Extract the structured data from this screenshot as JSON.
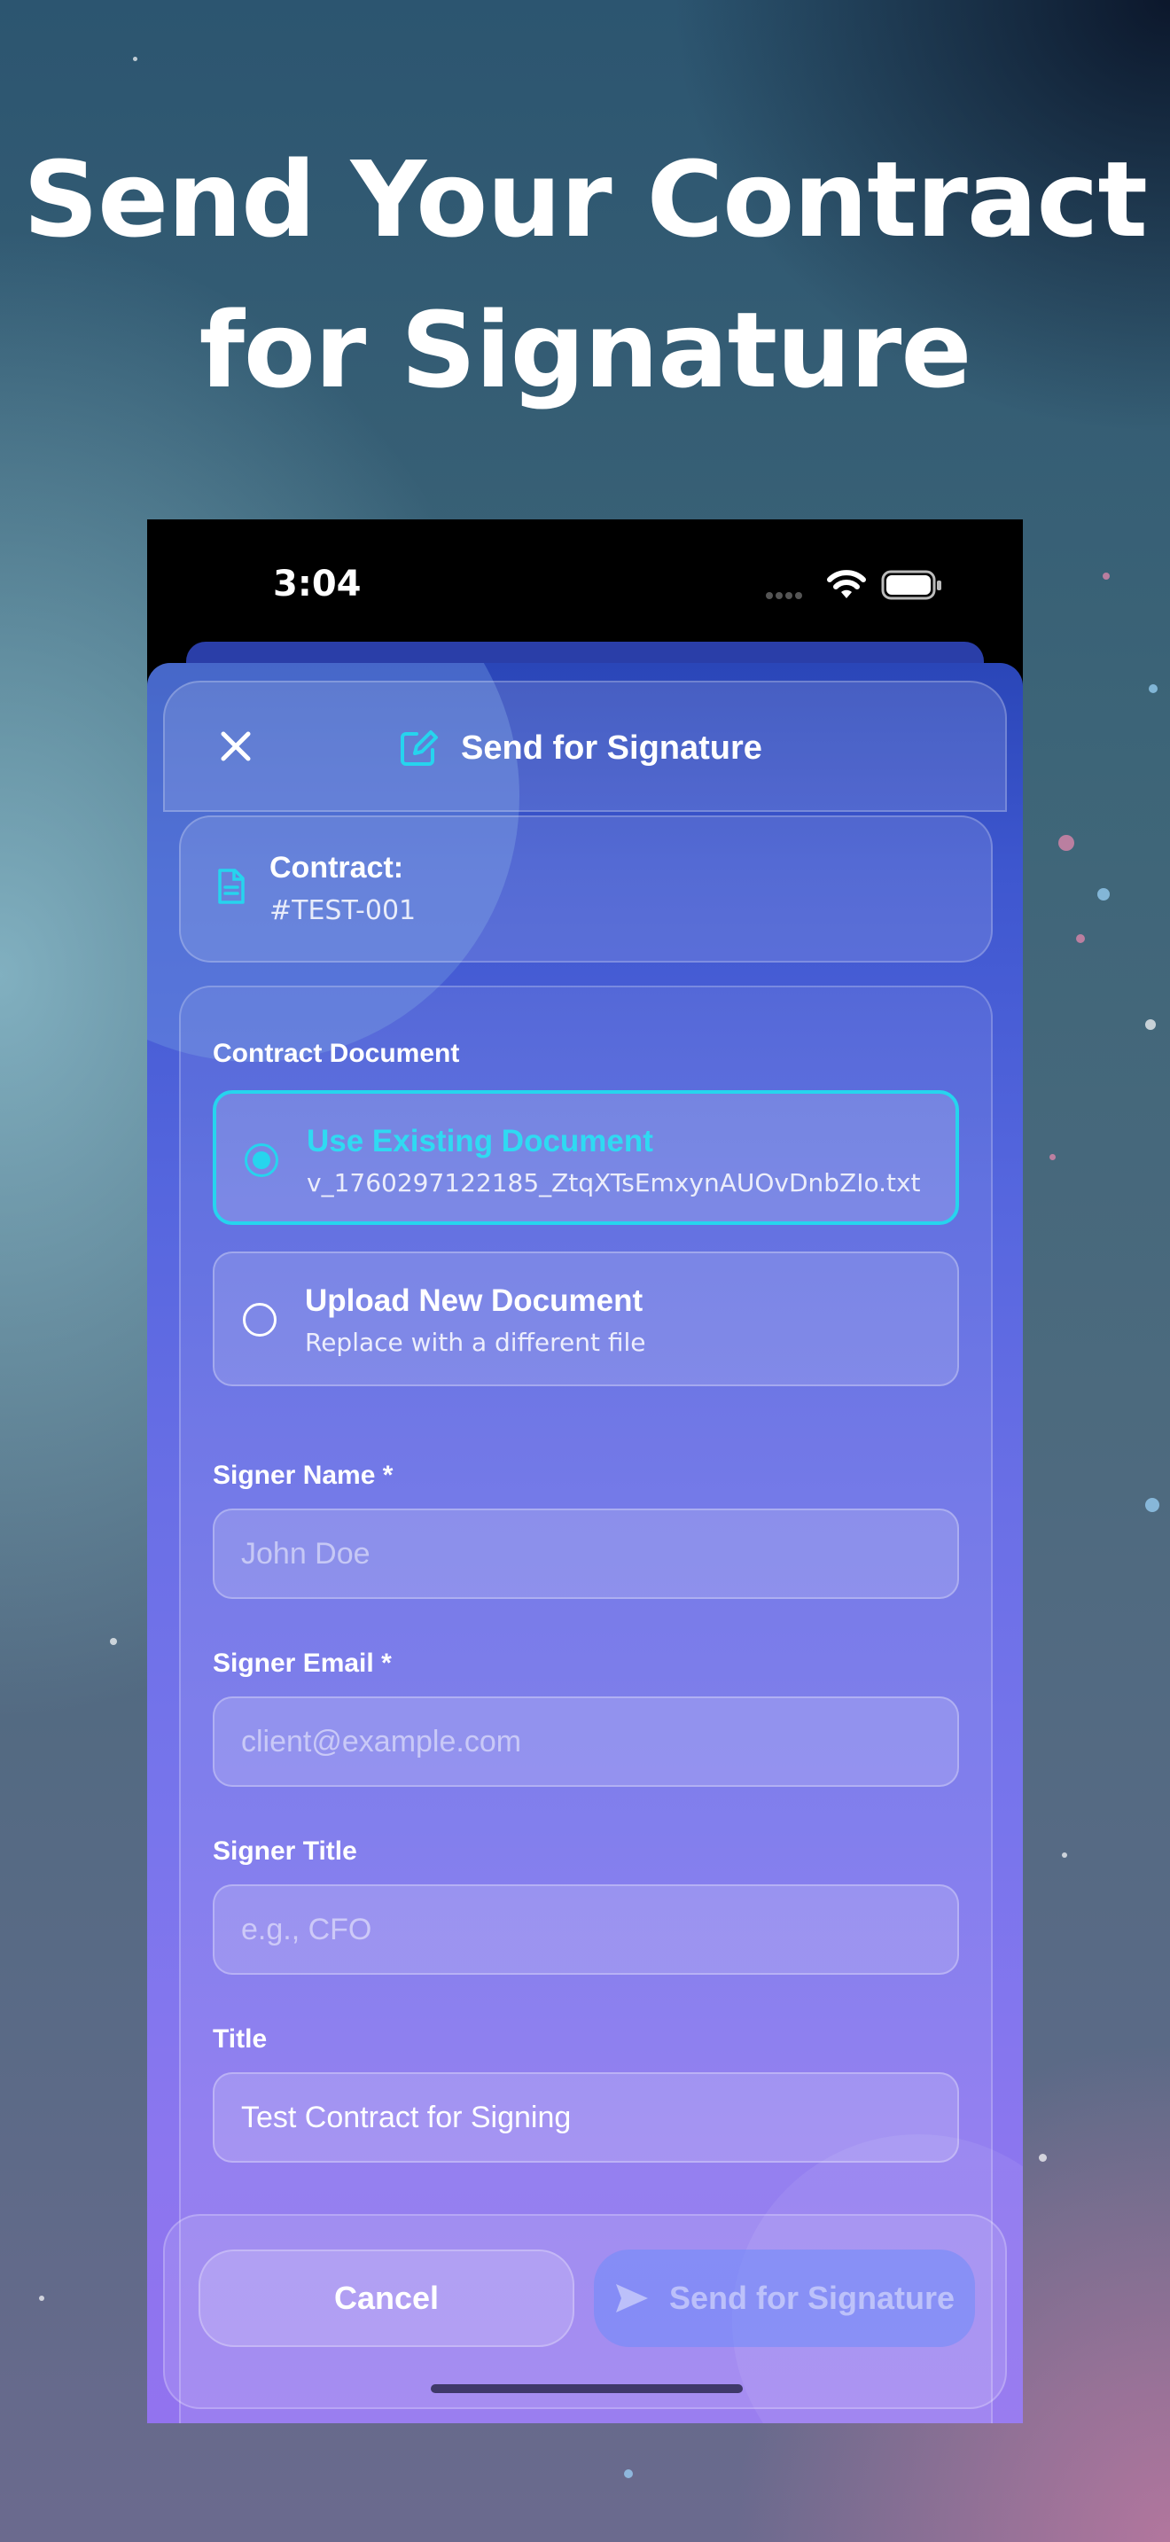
{
  "headline": {
    "line1": "Send Your Contract",
    "line2": "for Signature"
  },
  "status_bar": {
    "time": "3:04"
  },
  "nav": {
    "title": "Send for Signature",
    "close_icon": "close-icon",
    "title_icon": "edit-document-icon"
  },
  "contract": {
    "label": "Contract:",
    "id": "#TEST-001",
    "icon": "document-icon"
  },
  "document_section": {
    "label": "Contract Document",
    "options": [
      {
        "title": "Use Existing Document",
        "subtitle": "v_1760297122185_ZtqXTsEmxynAUOvDnbZIo.txt",
        "selected": true
      },
      {
        "title": "Upload New Document",
        "subtitle": "Replace with a different file",
        "selected": false
      }
    ]
  },
  "fields": {
    "signer_name": {
      "label": "Signer Name *",
      "placeholder": "John Doe",
      "value": ""
    },
    "signer_email": {
      "label": "Signer Email *",
      "placeholder": "client@example.com",
      "value": ""
    },
    "signer_title": {
      "label": "Signer Title",
      "placeholder": "e.g., CFO",
      "value": ""
    },
    "title": {
      "label": "Title",
      "placeholder": "",
      "value": "Test Contract for Signing"
    }
  },
  "footer": {
    "cancel_label": "Cancel",
    "send_label": "Send for Signature",
    "send_icon": "paper-plane-icon"
  },
  "colors": {
    "accent": "#26d4ee",
    "sheet_top": "#2a46b8",
    "sheet_bottom": "#9273ef"
  }
}
